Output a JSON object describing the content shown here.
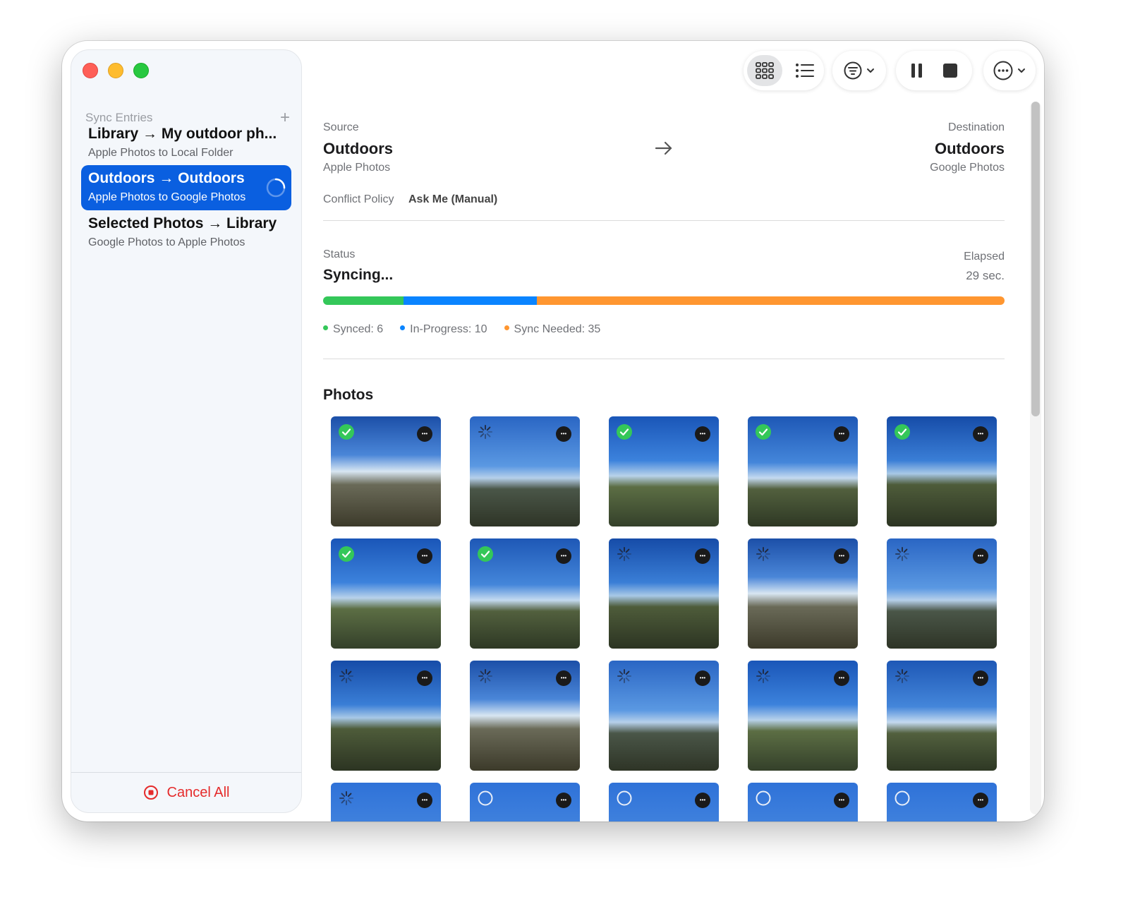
{
  "sidebar": {
    "title": "Sync Entries",
    "add_icon": "plus-icon",
    "entries": [
      {
        "title": "Library → My outdoor ph...",
        "subtitle": "Apple Photos to Local Folder"
      },
      {
        "title": "Outdoors → Outdoors",
        "subtitle": "Apple Photos to Google Photos"
      },
      {
        "title": "Selected Photos → Library",
        "subtitle": "Google Photos to Apple Photos"
      }
    ],
    "cancel_label": "Cancel All"
  },
  "source": {
    "label": "Source",
    "name": "Outdoors",
    "service": "Apple Photos"
  },
  "destination": {
    "label": "Destination",
    "name": "Outdoors",
    "service": "Google Photos"
  },
  "conflict": {
    "label": "Conflict Policy",
    "value": "Ask Me (Manual)"
  },
  "status": {
    "label": "Status",
    "value": "Syncing...",
    "elapsed_label": "Elapsed",
    "elapsed_value": "29 sec."
  },
  "progress": {
    "synced": 6,
    "in_progress": 10,
    "sync_needed": 35
  },
  "legend": {
    "synced": "Synced: 6",
    "in_progress": "In-Progress: 10",
    "sync_needed": "Sync Needed: 35"
  },
  "colors": {
    "synced": "#34c759",
    "in_progress": "#0a84ff",
    "sync_needed": "#ff9630",
    "accent": "#0a5fe0",
    "danger": "#e52b2b"
  },
  "photos": {
    "title": "Photos",
    "states": [
      "synced",
      "syncing",
      "synced",
      "synced",
      "synced",
      "synced",
      "synced",
      "syncing",
      "syncing",
      "syncing",
      "syncing",
      "syncing",
      "syncing",
      "syncing",
      "syncing",
      "syncing",
      "pending",
      "pending",
      "pending",
      "pending"
    ]
  }
}
